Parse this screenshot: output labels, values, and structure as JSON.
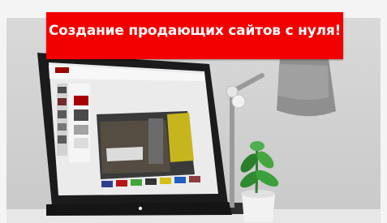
{
  "banner": {
    "text": "Создание продающих сайтов с нуля!"
  },
  "colors": {
    "banner_background": "#f20000",
    "banner_text": "#ffffff",
    "wall": "#d3d3d3",
    "monitor": "#1b1b1d",
    "lamp": "#8f8f8f"
  },
  "icons": {
    "monitor": "monitor-icon",
    "lamp": "desk-lamp-icon",
    "plant": "potted-plant-icon"
  }
}
